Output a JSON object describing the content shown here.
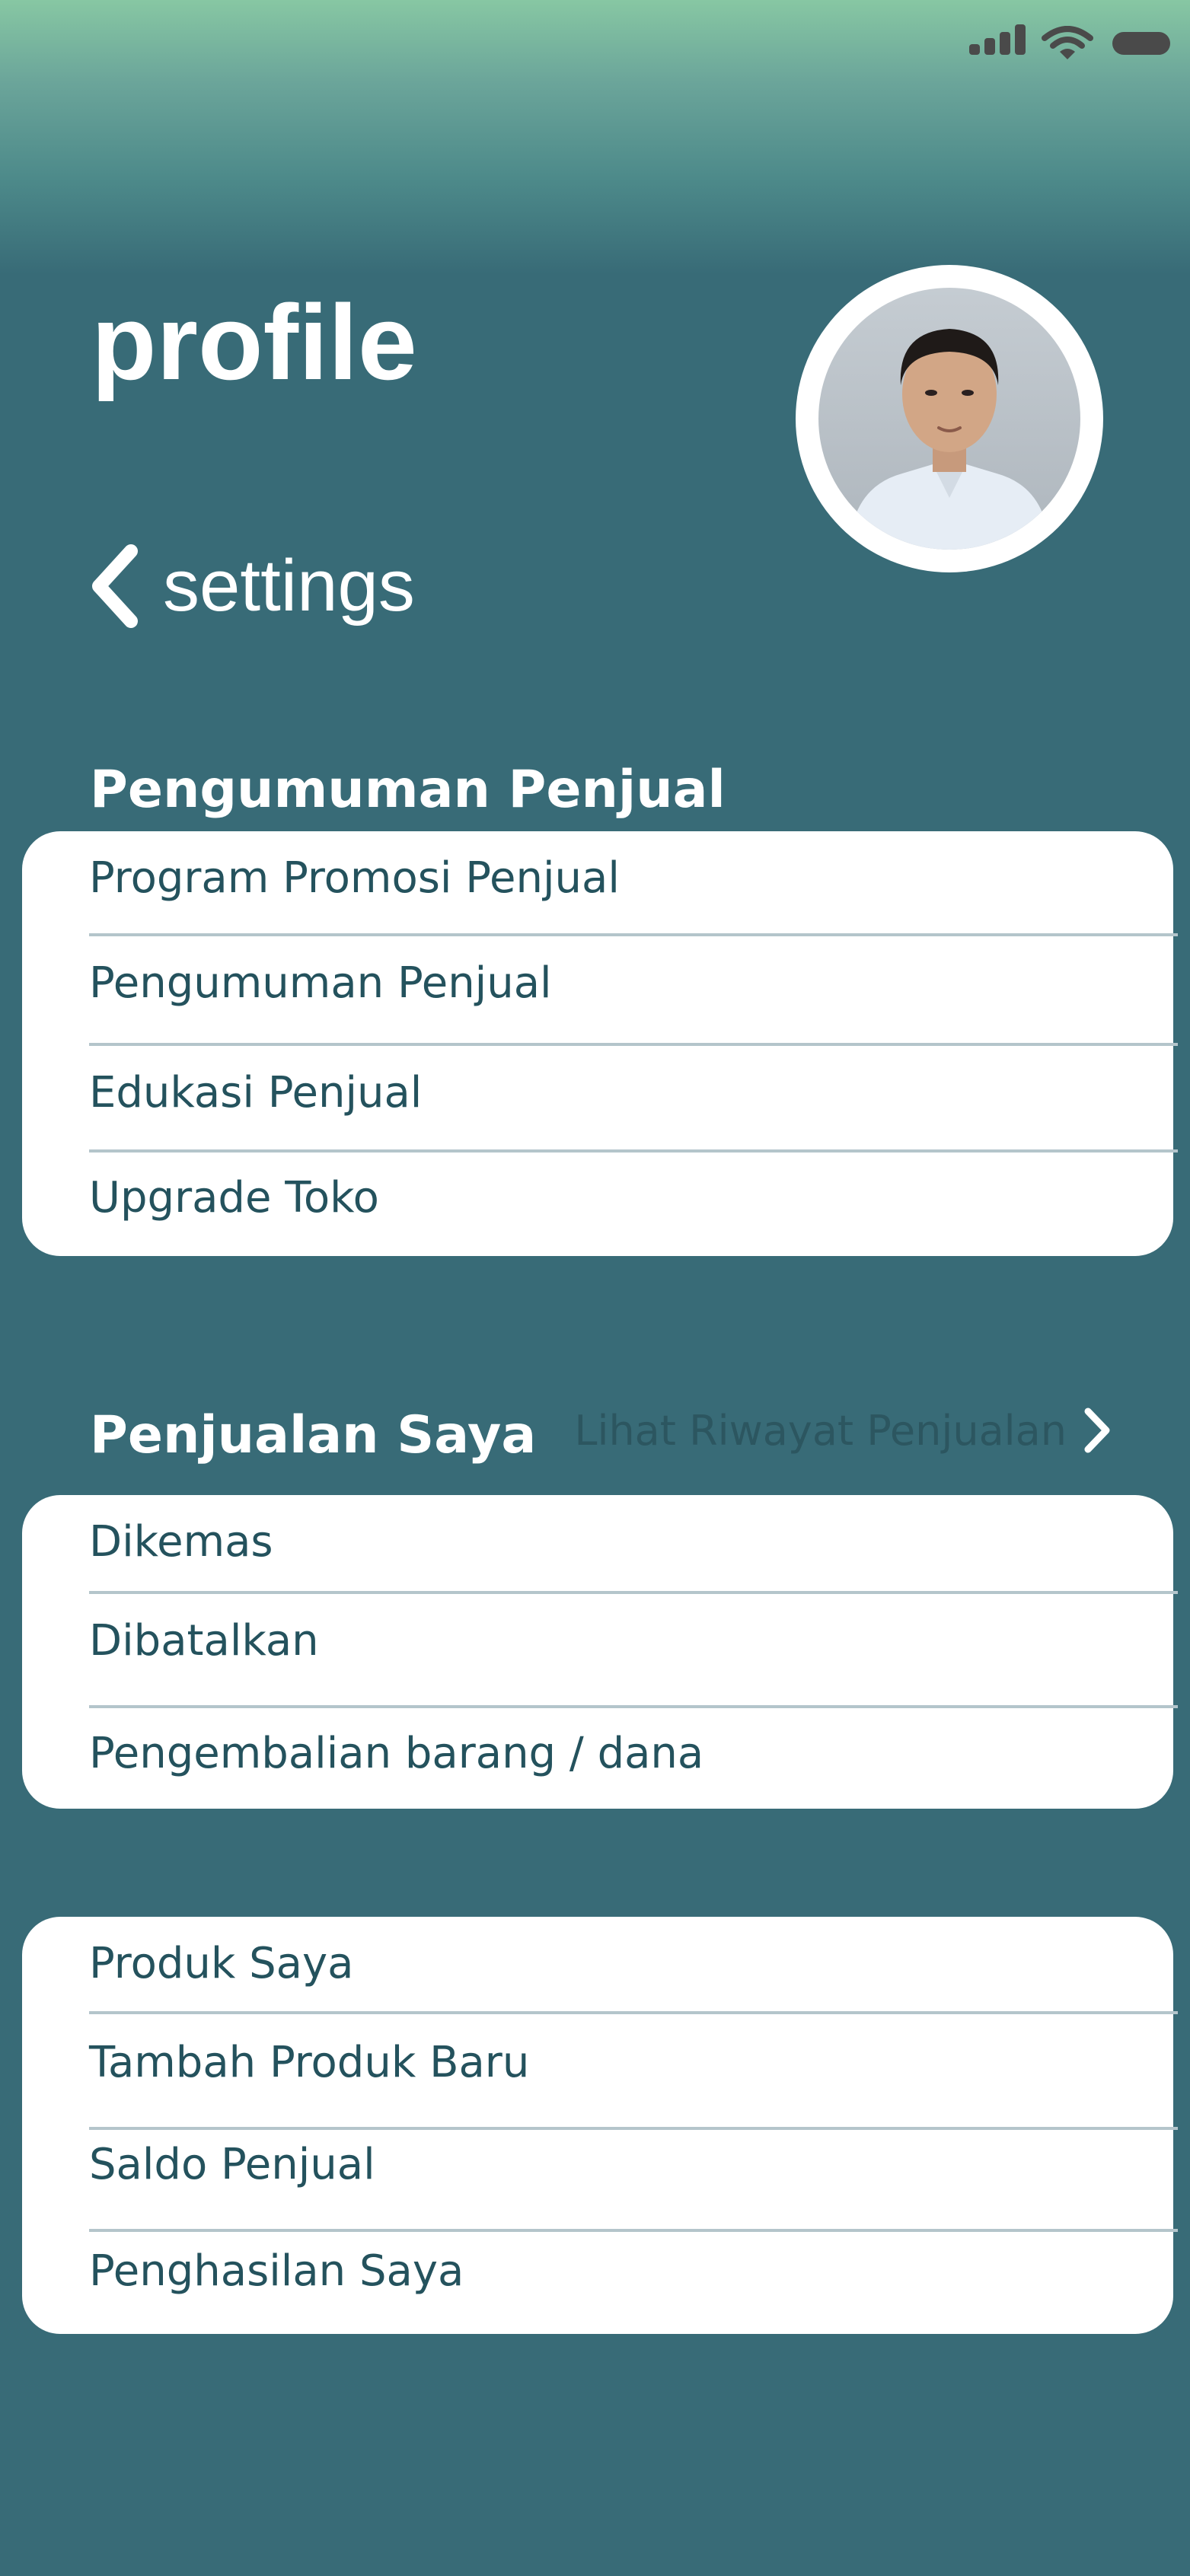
{
  "header": {
    "title": "profile",
    "back_label": "settings"
  },
  "sections": {
    "announcements": {
      "heading": "Pengumuman Penjual",
      "items": [
        "Program Promosi Penjual",
        "Pengumuman Penjual",
        "Edukasi Penjual",
        "Upgrade Toko"
      ]
    },
    "sales": {
      "heading": "Penjualan Saya",
      "link_label": "Lihat Riwayat Penjualan",
      "items": [
        "Dikemas",
        "Dibatalkan",
        "Pengembalian barang / dana"
      ]
    },
    "products": {
      "items": [
        "Produk Saya",
        "Tambah Produk Baru",
        "Saldo Penjual",
        "Penghasilan Saya"
      ]
    }
  },
  "icons": {
    "back": "chevron-left-icon",
    "link": "chevron-right-icon",
    "status": [
      "signal-icon",
      "wifi-icon",
      "battery-icon"
    ]
  },
  "colors": {
    "background": "#386b77",
    "gradient_top": "#87c7a3",
    "card": "#ffffff",
    "item_text": "#24525d",
    "divider": "#b4c5cb",
    "link_text": "#2c5660"
  }
}
